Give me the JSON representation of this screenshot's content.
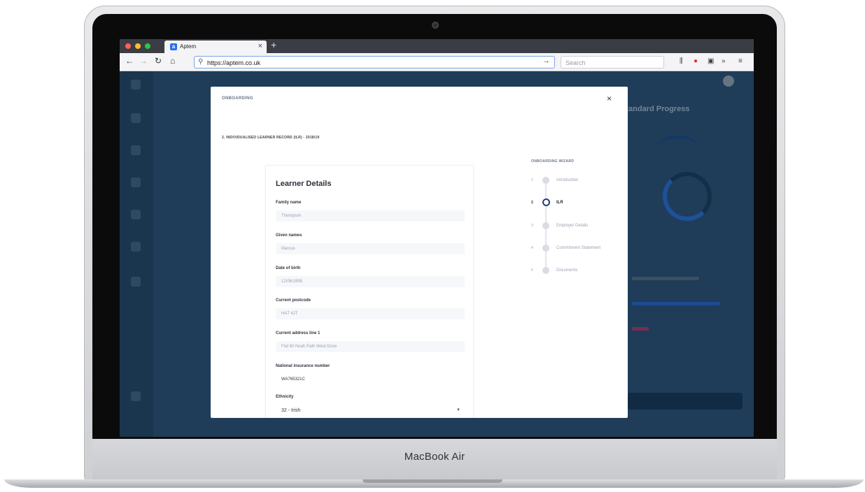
{
  "device": {
    "brand": "MacBook Air"
  },
  "browser": {
    "tab_title": "Aptem",
    "tab_icon_letter": "a",
    "url": "https://aptem.co.uk",
    "search_placeholder": "Search"
  },
  "modal": {
    "header": "ONBOARDING",
    "section_title": "2. INDIVIDUALISED LEARNER RECORD (ILR) - 2018/19",
    "close_icon": "close-icon",
    "form": {
      "title": "Learner Details",
      "fields": [
        {
          "label": "Family name",
          "value": "Thompson"
        },
        {
          "label": "Given names",
          "value": "Marcus"
        },
        {
          "label": "Date of birth",
          "value": "12/06/1995"
        },
        {
          "label": "Current postcode",
          "value": "HA7 4JT"
        },
        {
          "label": "Current address line 1",
          "value": "Flat 60 Noah Path West Dove"
        },
        {
          "label": "National insurance number",
          "value": "WA765321C"
        },
        {
          "label": "Ethnicity",
          "value": "32 - Irish"
        }
      ]
    },
    "wizard": {
      "title": "ONBOARDING WIZARD",
      "steps": [
        {
          "number": "1",
          "label": "Introduction",
          "active": false
        },
        {
          "number": "2",
          "label": "ILR",
          "active": true
        },
        {
          "number": "3",
          "label": "Employer Details",
          "active": false
        },
        {
          "number": "4",
          "label": "Commitment Statement",
          "active": false
        },
        {
          "number": "5",
          "label": "Documents",
          "active": false
        }
      ]
    }
  },
  "background_app": {
    "panel_title": "Standard Progress"
  },
  "colors": {
    "app_bg": "#2c5073",
    "accent_blue": "#2a64c9",
    "active_step": "#23407a"
  }
}
